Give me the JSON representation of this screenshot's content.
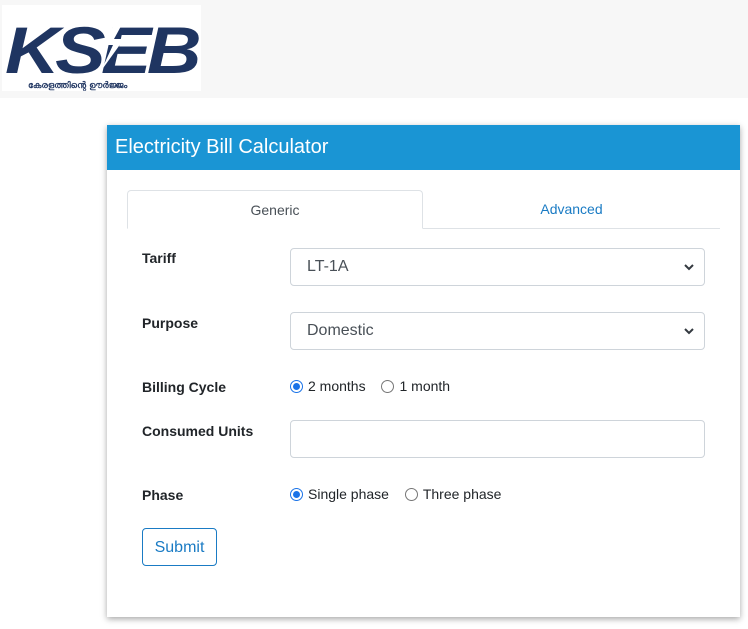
{
  "brand": {
    "logo_text": "KSEB",
    "tagline": "കേരളത്തിന്റെ ഊർജ്ജം",
    "primary_color": "#1a95d4",
    "logo_color": "#1f3561",
    "link_color": "#1a7bc4",
    "logo_icon": "lightning-bolt-icon"
  },
  "card": {
    "title": "Electricity Bill Calculator"
  },
  "tabs": [
    {
      "label": "Generic",
      "active": true
    },
    {
      "label": "Advanced",
      "active": false
    }
  ],
  "form": {
    "tariff": {
      "label": "Tariff",
      "value": "LT-1A"
    },
    "purpose": {
      "label": "Purpose",
      "value": "Domestic"
    },
    "billing_cycle": {
      "label": "Billing Cycle",
      "options": [
        {
          "label": "2 months",
          "checked": true
        },
        {
          "label": "1 month",
          "checked": false
        }
      ]
    },
    "consumed_units": {
      "label": "Consumed Units",
      "value": "",
      "placeholder": ""
    },
    "phase": {
      "label": "Phase",
      "options": [
        {
          "label": "Single phase",
          "checked": true
        },
        {
          "label": "Three phase",
          "checked": false
        }
      ]
    },
    "submit_label": "Submit"
  }
}
